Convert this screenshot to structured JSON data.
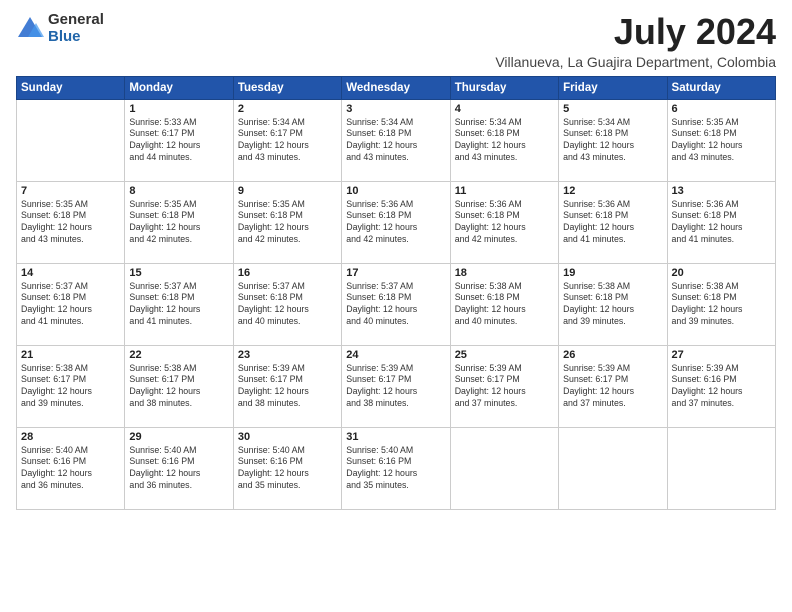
{
  "logo": {
    "general": "General",
    "blue": "Blue"
  },
  "header": {
    "month_year": "July 2024",
    "location": "Villanueva, La Guajira Department, Colombia"
  },
  "weekdays": [
    "Sunday",
    "Monday",
    "Tuesday",
    "Wednesday",
    "Thursday",
    "Friday",
    "Saturday"
  ],
  "weeks": [
    [
      {
        "day": "",
        "info": ""
      },
      {
        "day": "1",
        "info": "Sunrise: 5:33 AM\nSunset: 6:17 PM\nDaylight: 12 hours\nand 44 minutes."
      },
      {
        "day": "2",
        "info": "Sunrise: 5:34 AM\nSunset: 6:17 PM\nDaylight: 12 hours\nand 43 minutes."
      },
      {
        "day": "3",
        "info": "Sunrise: 5:34 AM\nSunset: 6:18 PM\nDaylight: 12 hours\nand 43 minutes."
      },
      {
        "day": "4",
        "info": "Sunrise: 5:34 AM\nSunset: 6:18 PM\nDaylight: 12 hours\nand 43 minutes."
      },
      {
        "day": "5",
        "info": "Sunrise: 5:34 AM\nSunset: 6:18 PM\nDaylight: 12 hours\nand 43 minutes."
      },
      {
        "day": "6",
        "info": "Sunrise: 5:35 AM\nSunset: 6:18 PM\nDaylight: 12 hours\nand 43 minutes."
      }
    ],
    [
      {
        "day": "7",
        "info": "Sunrise: 5:35 AM\nSunset: 6:18 PM\nDaylight: 12 hours\nand 43 minutes."
      },
      {
        "day": "8",
        "info": "Sunrise: 5:35 AM\nSunset: 6:18 PM\nDaylight: 12 hours\nand 42 minutes."
      },
      {
        "day": "9",
        "info": "Sunrise: 5:35 AM\nSunset: 6:18 PM\nDaylight: 12 hours\nand 42 minutes."
      },
      {
        "day": "10",
        "info": "Sunrise: 5:36 AM\nSunset: 6:18 PM\nDaylight: 12 hours\nand 42 minutes."
      },
      {
        "day": "11",
        "info": "Sunrise: 5:36 AM\nSunset: 6:18 PM\nDaylight: 12 hours\nand 42 minutes."
      },
      {
        "day": "12",
        "info": "Sunrise: 5:36 AM\nSunset: 6:18 PM\nDaylight: 12 hours\nand 41 minutes."
      },
      {
        "day": "13",
        "info": "Sunrise: 5:36 AM\nSunset: 6:18 PM\nDaylight: 12 hours\nand 41 minutes."
      }
    ],
    [
      {
        "day": "14",
        "info": "Sunrise: 5:37 AM\nSunset: 6:18 PM\nDaylight: 12 hours\nand 41 minutes."
      },
      {
        "day": "15",
        "info": "Sunrise: 5:37 AM\nSunset: 6:18 PM\nDaylight: 12 hours\nand 41 minutes."
      },
      {
        "day": "16",
        "info": "Sunrise: 5:37 AM\nSunset: 6:18 PM\nDaylight: 12 hours\nand 40 minutes."
      },
      {
        "day": "17",
        "info": "Sunrise: 5:37 AM\nSunset: 6:18 PM\nDaylight: 12 hours\nand 40 minutes."
      },
      {
        "day": "18",
        "info": "Sunrise: 5:38 AM\nSunset: 6:18 PM\nDaylight: 12 hours\nand 40 minutes."
      },
      {
        "day": "19",
        "info": "Sunrise: 5:38 AM\nSunset: 6:18 PM\nDaylight: 12 hours\nand 39 minutes."
      },
      {
        "day": "20",
        "info": "Sunrise: 5:38 AM\nSunset: 6:18 PM\nDaylight: 12 hours\nand 39 minutes."
      }
    ],
    [
      {
        "day": "21",
        "info": "Sunrise: 5:38 AM\nSunset: 6:17 PM\nDaylight: 12 hours\nand 39 minutes."
      },
      {
        "day": "22",
        "info": "Sunrise: 5:38 AM\nSunset: 6:17 PM\nDaylight: 12 hours\nand 38 minutes."
      },
      {
        "day": "23",
        "info": "Sunrise: 5:39 AM\nSunset: 6:17 PM\nDaylight: 12 hours\nand 38 minutes."
      },
      {
        "day": "24",
        "info": "Sunrise: 5:39 AM\nSunset: 6:17 PM\nDaylight: 12 hours\nand 38 minutes."
      },
      {
        "day": "25",
        "info": "Sunrise: 5:39 AM\nSunset: 6:17 PM\nDaylight: 12 hours\nand 37 minutes."
      },
      {
        "day": "26",
        "info": "Sunrise: 5:39 AM\nSunset: 6:17 PM\nDaylight: 12 hours\nand 37 minutes."
      },
      {
        "day": "27",
        "info": "Sunrise: 5:39 AM\nSunset: 6:16 PM\nDaylight: 12 hours\nand 37 minutes."
      }
    ],
    [
      {
        "day": "28",
        "info": "Sunrise: 5:40 AM\nSunset: 6:16 PM\nDaylight: 12 hours\nand 36 minutes."
      },
      {
        "day": "29",
        "info": "Sunrise: 5:40 AM\nSunset: 6:16 PM\nDaylight: 12 hours\nand 36 minutes."
      },
      {
        "day": "30",
        "info": "Sunrise: 5:40 AM\nSunset: 6:16 PM\nDaylight: 12 hours\nand 35 minutes."
      },
      {
        "day": "31",
        "info": "Sunrise: 5:40 AM\nSunset: 6:16 PM\nDaylight: 12 hours\nand 35 minutes."
      },
      {
        "day": "",
        "info": ""
      },
      {
        "day": "",
        "info": ""
      },
      {
        "day": "",
        "info": ""
      }
    ]
  ]
}
